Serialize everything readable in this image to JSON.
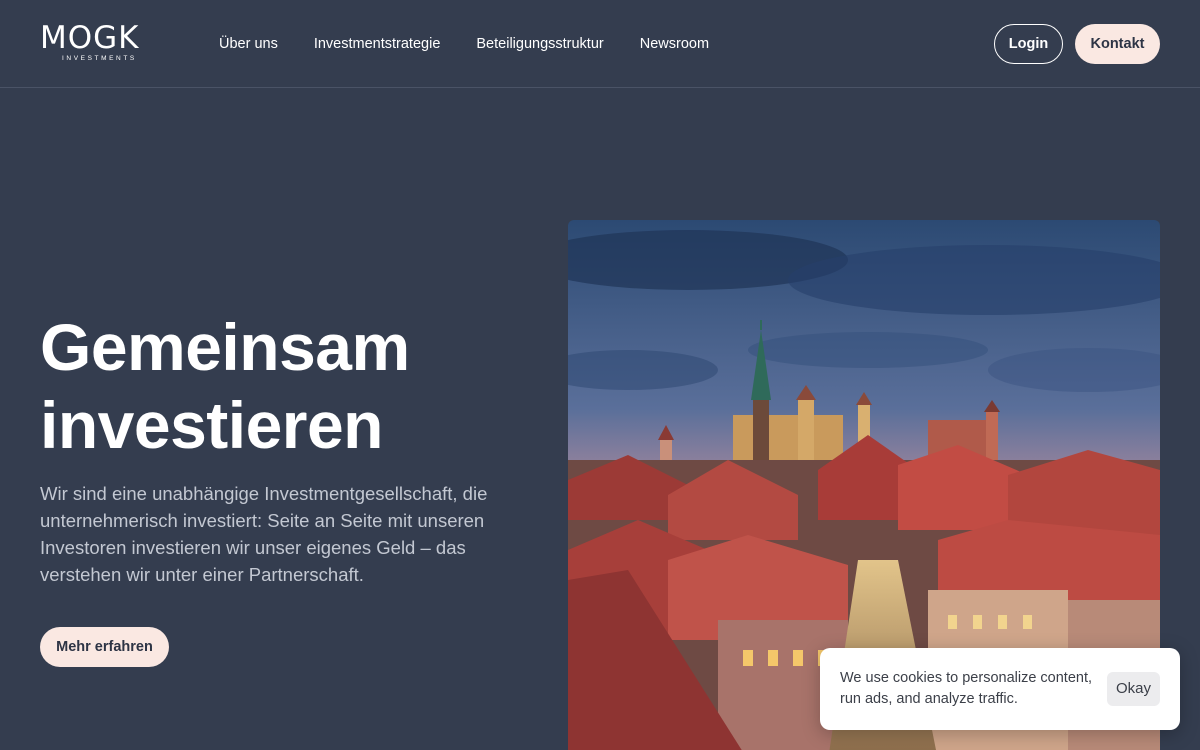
{
  "header": {
    "logo": {
      "main": "MOGK",
      "sub": "INVESTMENTS"
    },
    "nav": [
      {
        "label": "Über uns"
      },
      {
        "label": "Investmentstrategie"
      },
      {
        "label": "Beteiligungsstruktur"
      },
      {
        "label": "Newsroom"
      }
    ],
    "login_label": "Login",
    "contact_label": "Kontakt"
  },
  "hero": {
    "title_line1": "Gemeinsam",
    "title_line2": "investieren",
    "text": "Wir sind eine unabhängige Investmentgesellschaft, die unternehmerisch investiert:   Seite an Seite mit unseren Investoren investieren wir unser eigenes Geld – das verstehen wir unter einer Partnerschaft.",
    "cta_label": "Mehr erfahren"
  },
  "cookie_banner": {
    "text": "We use cookies to personalize content, run ads, and analyze traffic.",
    "button_label": "Okay"
  },
  "colors": {
    "background": "#343d4f",
    "accent_button": "#fae8e2",
    "text_muted": "#c3c8d2"
  }
}
